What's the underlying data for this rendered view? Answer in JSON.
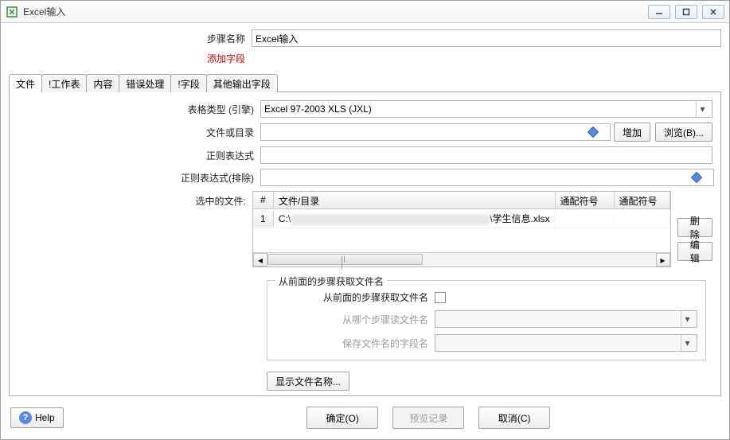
{
  "window": {
    "title": "Excel输入"
  },
  "form": {
    "step_name_label": "步骤名称",
    "step_name_value": "Excel输入",
    "add_field_link": "添加字段"
  },
  "tabs": [
    "文件",
    "!工作表",
    "内容",
    "错误处理",
    "!字段",
    "其他输出字段"
  ],
  "active_tab": 0,
  "file_tab": {
    "table_type_label": "表格类型 (引擎)",
    "table_type_value": "Excel 97-2003 XLS (JXL)",
    "file_or_dir_label": "文件或目录",
    "file_or_dir_value": "",
    "add_btn": "增加",
    "browse_btn": "浏览(B)...",
    "regex_label": "正则表达式",
    "regex_value": "",
    "regex_excl_label": "正则表达式(排除)",
    "regex_excl_value": "",
    "selected_files_label": "选中的文件:",
    "table": {
      "headers": {
        "num": "#",
        "path": "文件/目录",
        "wildcard": "通配符号",
        "wildcard2": "通配符号"
      },
      "rows": [
        {
          "num": "1",
          "path_prefix": "C:\\",
          "path_hidden": "████████████████████",
          "path_suffix": "\\学生信息.xlsx"
        }
      ]
    },
    "delete_btn": "删除",
    "edit_btn": "编辑",
    "fieldset": {
      "legend": "从前面的步骤获取文件名",
      "checkbox_label": "从前面的步骤获取文件名",
      "checkbox_checked": false,
      "step_select_label": "从哪个步骤读文件名",
      "field_select_label": "保存文件名的字段名"
    },
    "show_files_btn": "显示文件名称..."
  },
  "footer": {
    "help": "Help",
    "ok": "确定(O)",
    "preview": "预览记录",
    "cancel": "取消(C)"
  }
}
